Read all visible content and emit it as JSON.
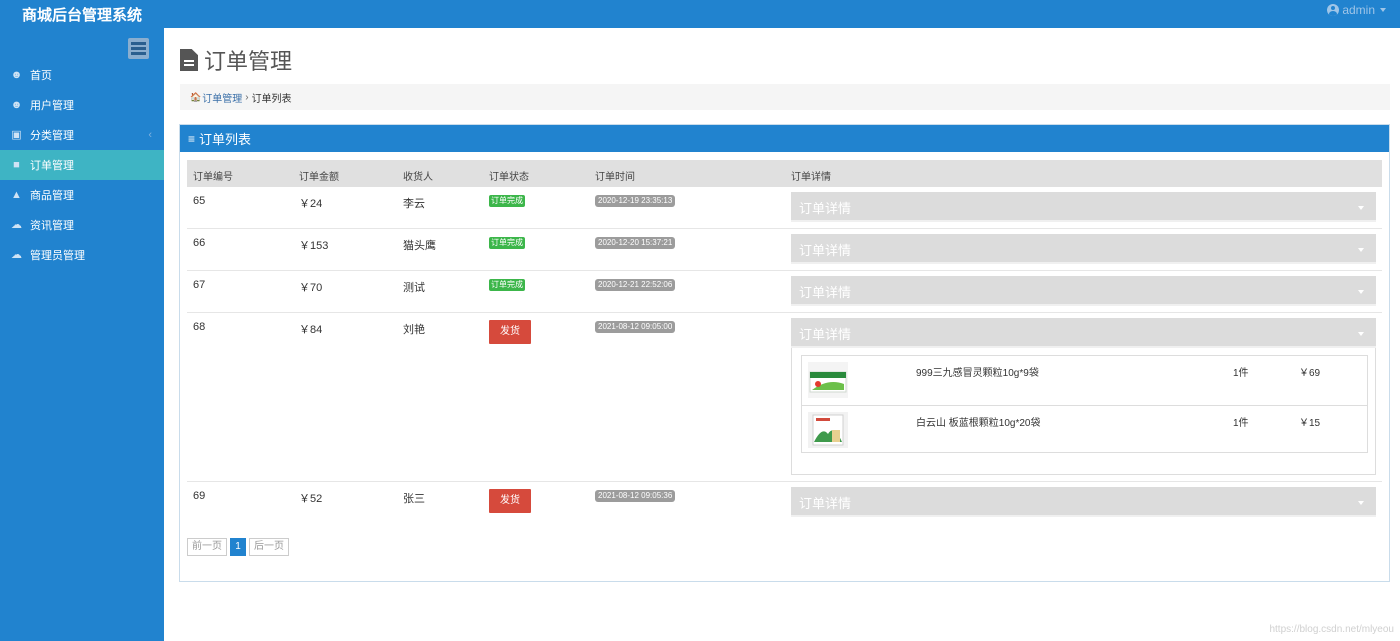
{
  "header": {
    "brand": "商城后台管理系统",
    "user": "admin"
  },
  "sidebar": {
    "items": [
      {
        "label": "首页",
        "icon": "user-circle-icon",
        "glyph": "☻"
      },
      {
        "label": "用户管理",
        "icon": "user-circle-icon",
        "glyph": "☻"
      },
      {
        "label": "分类管理",
        "icon": "picture-icon",
        "glyph": "▣"
      },
      {
        "label": "订单管理",
        "icon": "file-icon",
        "glyph": "■"
      },
      {
        "label": "商品管理",
        "icon": "bag-icon",
        "glyph": "▲"
      },
      {
        "label": "资讯管理",
        "icon": "chat-icon",
        "glyph": "☁"
      },
      {
        "label": "管理员管理",
        "icon": "chat-icon",
        "glyph": "☁"
      }
    ],
    "active_index": 3,
    "expand_glyph": "‹"
  },
  "page": {
    "title": "订单管理"
  },
  "breadcrumb": {
    "home_glyph": "🏠",
    "link": "订单管理",
    "sep": "›",
    "current": "订单列表"
  },
  "panel": {
    "title": "订单列表",
    "glyph": "≡"
  },
  "table": {
    "headers": [
      "订单编号",
      "订单金额",
      "收货人",
      "订单状态",
      "订单时间",
      "订单详情"
    ],
    "rows": [
      {
        "id": "65",
        "amount": "￥24",
        "receiver": "李云",
        "status": "订单完成",
        "time": "2020-12-19 23:35:13",
        "detail": "订单详情"
      },
      {
        "id": "66",
        "amount": "￥153",
        "receiver": "猫头鹰",
        "status": "订单完成",
        "time": "2020-12-20 15:37:21",
        "detail": "订单详情"
      },
      {
        "id": "67",
        "amount": "￥70",
        "receiver": "测试",
        "status": "订单完成",
        "time": "2020-12-21 22:52:06",
        "detail": "订单详情"
      },
      {
        "id": "68",
        "amount": "￥84",
        "receiver": "刘艳",
        "status": "发货",
        "time": "2021-08-12 09:05:00",
        "detail": "订单详情",
        "items": [
          {
            "name": "999三九感冒灵颗粒10g*9袋",
            "qty": "1件",
            "price": "￥69"
          },
          {
            "name": "白云山 板蓝根颗粒10g*20袋",
            "qty": "1件",
            "price": "￥15"
          }
        ]
      },
      {
        "id": "69",
        "amount": "￥52",
        "receiver": "张三",
        "status": "发货",
        "time": "2021-08-12 09:05:36",
        "detail": "订单详情"
      }
    ]
  },
  "pager": {
    "prev": "前一页",
    "current": "1",
    "next": "后一页"
  },
  "watermark": "https://blog.csdn.net/mlyeou",
  "colors": {
    "brand": "#2183cf",
    "active": "#3eb4c4",
    "done": "#3cb64a",
    "ship": "#d64a3c"
  }
}
